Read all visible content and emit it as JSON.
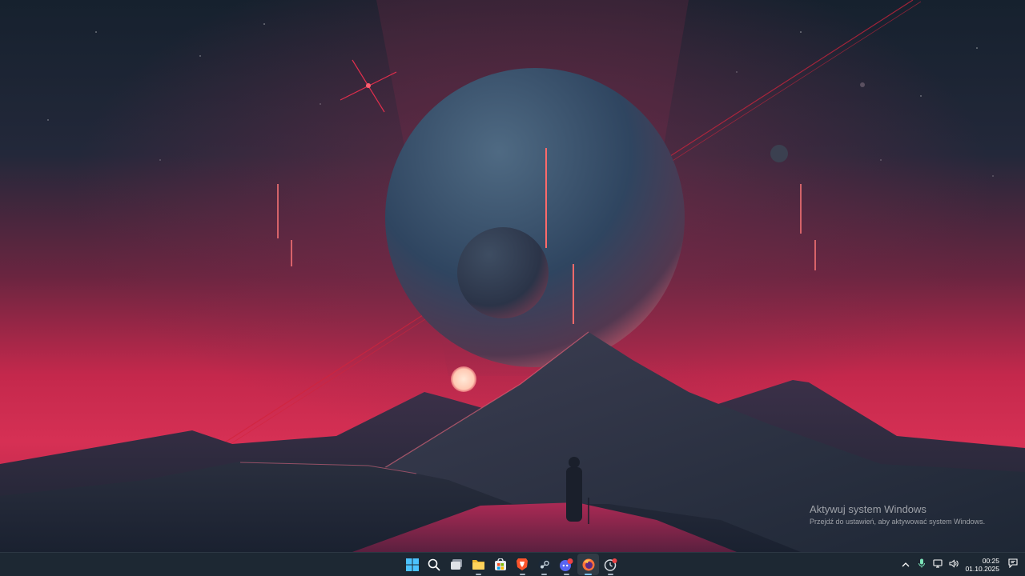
{
  "desktop": {
    "wallpaper_icon": "sci-fi-planet-landscape",
    "watermark": {
      "title": "Aktywuj system Windows",
      "subtitle": "Przejdź do ustawień, aby aktywować system Windows."
    }
  },
  "taskbar": {
    "pinned_apps": [
      {
        "name": "Start",
        "icon": "windows-logo-icon"
      },
      {
        "name": "Search",
        "icon": "search-icon"
      },
      {
        "name": "Task View",
        "icon": "task-view-icon"
      },
      {
        "name": "File Explorer",
        "icon": "folder-icon"
      },
      {
        "name": "Microsoft Store",
        "icon": "store-icon"
      },
      {
        "name": "Brave",
        "icon": "brave-icon"
      },
      {
        "name": "Steam",
        "icon": "steam-icon"
      },
      {
        "name": "Discord",
        "icon": "discord-icon",
        "badge": "20+"
      },
      {
        "name": "Firefox",
        "icon": "firefox-icon",
        "active": true
      },
      {
        "name": "Clock app",
        "icon": "clock-icon"
      }
    ],
    "tray": {
      "chevron_icon": "chevron-up-icon",
      "mic_icon": "microphone-icon",
      "network_icon": "network-icon",
      "volume_icon": "volume-icon",
      "notification_icon": "notification-icon"
    },
    "clock": {
      "time": "00:25",
      "date": "01.10.2025"
    },
    "colors": {
      "taskbar_bg": "#1d2833",
      "active_indicator": "#7ec4f5"
    }
  }
}
